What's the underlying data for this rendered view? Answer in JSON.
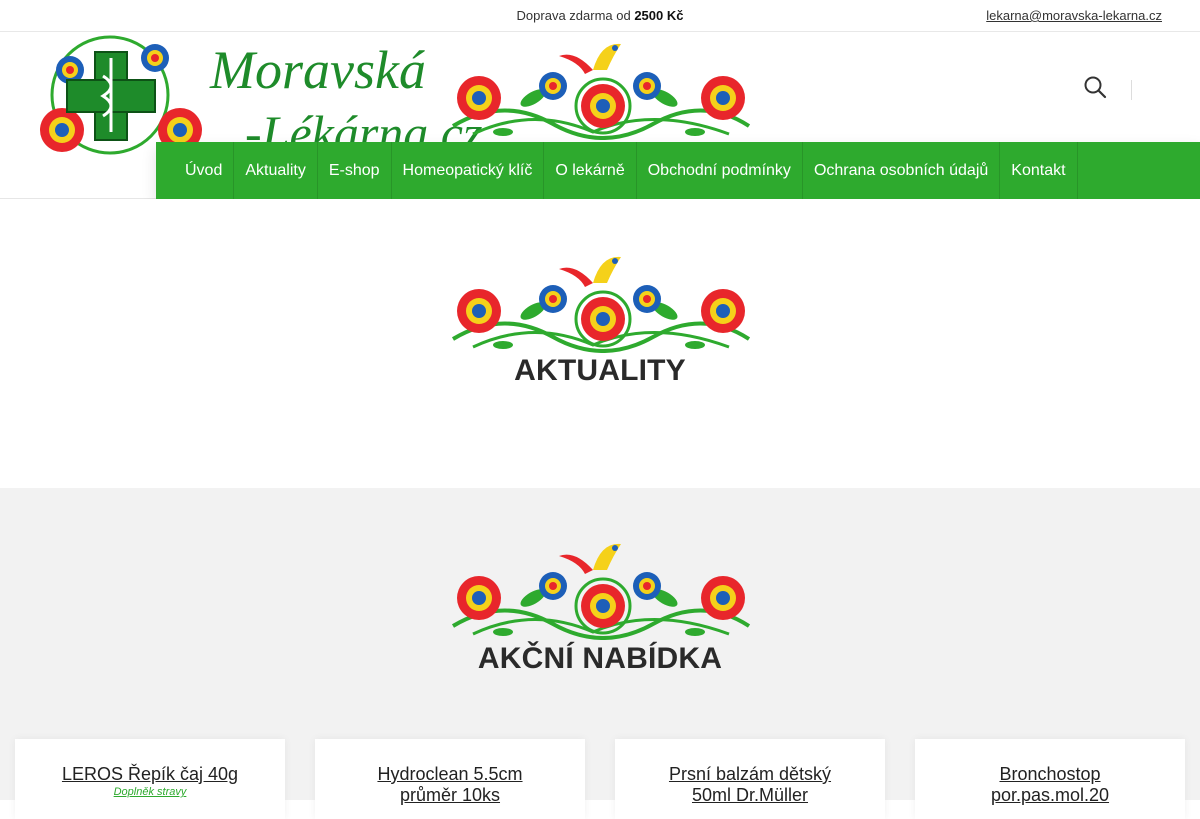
{
  "topbar": {
    "shipping_text": "Doprava zdarma od ",
    "shipping_amount": "2500 Kč",
    "email": "lekarna@moravska-lekarna.cz"
  },
  "logo": {
    "line1": "Moravská",
    "line2": "-Lékárna.cz"
  },
  "icons": {
    "search": "search-icon",
    "pharmacy_cross": "pharmacy-cross-icon",
    "folk_ornament": "folk-ornament"
  },
  "nav": {
    "items": [
      {
        "label": "Úvod"
      },
      {
        "label": "Aktuality"
      },
      {
        "label": "E-shop"
      },
      {
        "label": "Homeopatický klíč"
      },
      {
        "label": "O lekárně"
      },
      {
        "label": "Obchodní podmínky"
      },
      {
        "label": "Ochrana osobních údajů"
      },
      {
        "label": "Kontakt"
      }
    ]
  },
  "sections": {
    "news_title": "AKTUALITY",
    "offer_title": "AKČNÍ NABÍDKA"
  },
  "products": [
    {
      "title_line1": "LEROS Řepík čaj 40g",
      "title_line2": "",
      "category": "Doplněk stravy"
    },
    {
      "title_line1": "Hydroclean 5.5cm",
      "title_line2": "průměr 10ks",
      "category": ""
    },
    {
      "title_line1": "Prsní balzám dětský",
      "title_line2": "50ml Dr.Müller",
      "category": ""
    },
    {
      "title_line1": "Bronchostop",
      "title_line2": "por.pas.mol.20",
      "category": ""
    }
  ],
  "colors": {
    "accent_green": "#2eaa2e",
    "offer_bg": "#f2f2f2",
    "title_text": "#2a2a2a"
  }
}
